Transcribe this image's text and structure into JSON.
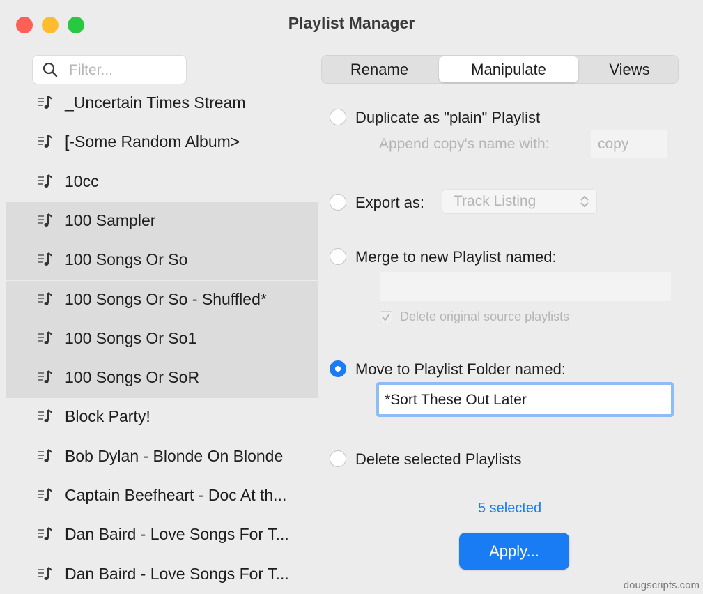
{
  "window": {
    "title": "Playlist Manager",
    "traffic_colors": {
      "close": "#fe5f57",
      "minimize": "#febc2e",
      "zoom": "#28c840"
    }
  },
  "filter": {
    "placeholder": "Filter...",
    "icon": "search-icon"
  },
  "playlists": [
    {
      "label": "_Uncertain Times Stream",
      "selected": false
    },
    {
      "label": "[-Some Random Album>",
      "selected": false
    },
    {
      "label": "10cc",
      "selected": false
    },
    {
      "label": "100 Sampler",
      "selected": true
    },
    {
      "label": "100 Songs Or So",
      "selected": true
    },
    {
      "label": "100 Songs Or So - Shuffled*",
      "selected": true
    },
    {
      "label": "100 Songs Or So1",
      "selected": true
    },
    {
      "label": "100 Songs Or SoR",
      "selected": true
    },
    {
      "label": "Block Party!",
      "selected": false
    },
    {
      "label": "Bob Dylan - Blonde On Blonde",
      "selected": false
    },
    {
      "label": "Captain Beefheart - Doc At th...",
      "selected": false
    },
    {
      "label": "Dan Baird - Love Songs For T...",
      "selected": false
    },
    {
      "label": "Dan Baird - Love Songs For T...",
      "selected": false
    }
  ],
  "tabs": [
    {
      "label": "Rename",
      "active": false
    },
    {
      "label": "Manipulate",
      "active": true
    },
    {
      "label": "Views",
      "active": false
    }
  ],
  "options": {
    "duplicate": {
      "label": "Duplicate as \"plain\" Playlist",
      "append_label": "Append copy's name with:",
      "append_value": "copy"
    },
    "export": {
      "label": "Export as:",
      "value": "Track Listing"
    },
    "merge": {
      "label": "Merge to new Playlist named:",
      "value": "",
      "delete_label": "Delete original source playlists",
      "delete_checked": true
    },
    "move": {
      "label": "Move to Playlist Folder named:",
      "value": "*Sort These Out Later",
      "checked": true
    },
    "delete": {
      "label": "Delete selected Playlists"
    }
  },
  "status": {
    "selected_count": "5 selected"
  },
  "apply_label": "Apply...",
  "footer": "dougscripts.com",
  "colors": {
    "accent": "#1a7cf5",
    "selection": "#dcdcdc",
    "background": "#ececec"
  }
}
